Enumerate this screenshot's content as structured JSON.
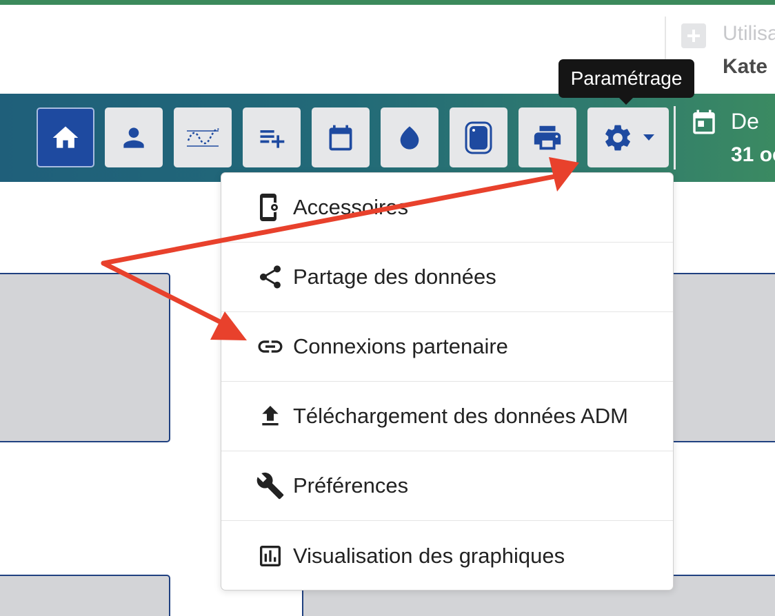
{
  "header": {
    "add_user_label": "Utilisa",
    "user_name": "Kate"
  },
  "toolbar": {
    "buttons": [
      {
        "icon": "home-icon",
        "active": true
      },
      {
        "icon": "person-icon"
      },
      {
        "icon": "trend-chart-icon"
      },
      {
        "icon": "add-note-icon"
      },
      {
        "icon": "calendar-icon"
      },
      {
        "icon": "drop-icon"
      },
      {
        "icon": "device-icon"
      },
      {
        "icon": "printer-icon"
      },
      {
        "icon": "gear-icon",
        "has_caret": true
      }
    ],
    "date_from_label": "De",
    "date_value": "31 oc"
  },
  "tooltip": {
    "text": "Paramétrage"
  },
  "settings_menu": {
    "items": [
      {
        "icon": "phone-settings-icon",
        "label": "Accessoires"
      },
      {
        "icon": "share-icon",
        "label": "Partage des données"
      },
      {
        "icon": "link-icon",
        "label": "Connexions partenaire"
      },
      {
        "icon": "upload-icon",
        "label": "Téléchargement des données ADM"
      },
      {
        "icon": "wrench-icon",
        "label": "Préférences"
      },
      {
        "icon": "bar-chart-icon",
        "label": "Visualisation des graphiques"
      }
    ]
  },
  "colors": {
    "accent_blue": "#1e4aa0",
    "annotation_red": "#e8412c",
    "toolbar_start": "#1f5f7a",
    "toolbar_end": "#3b8a62"
  }
}
